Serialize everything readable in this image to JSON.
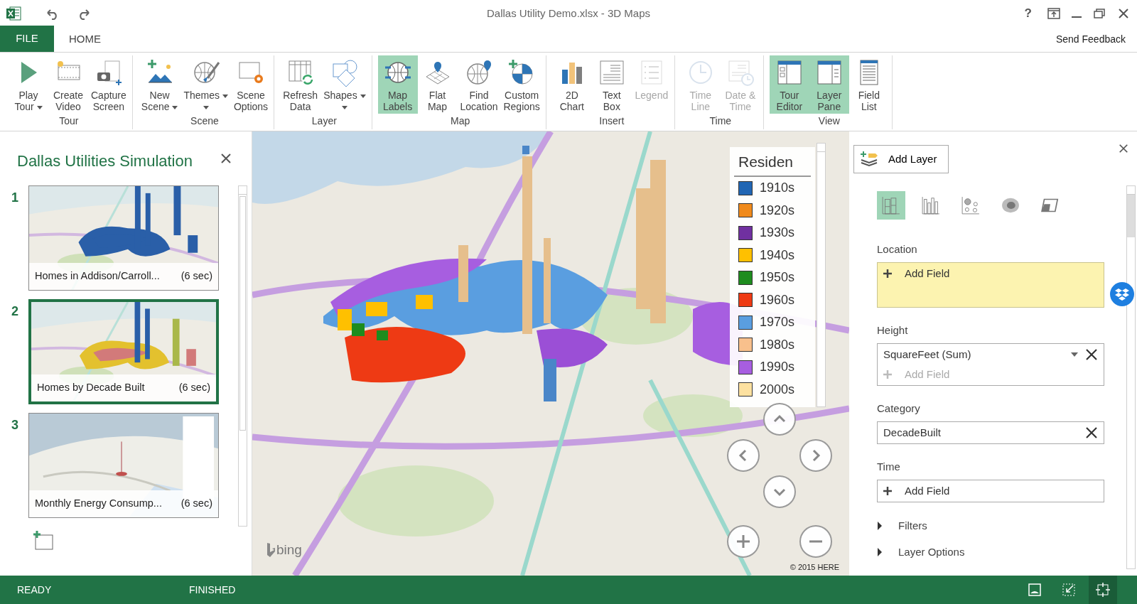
{
  "window": {
    "title": "Dallas Utility Demo.xlsx - 3D Maps",
    "help": "?"
  },
  "tabs": [
    {
      "label": "FILE",
      "kind": "file",
      "selected": false
    },
    {
      "label": "HOME",
      "kind": "tab",
      "selected": true
    }
  ],
  "send_feedback": "Send Feedback",
  "ribbon": {
    "groups": [
      {
        "label": "Tour",
        "buttons": [
          {
            "lines": [
              "Play",
              "Tour"
            ],
            "dropdown": true,
            "selected": false,
            "disabled": false
          },
          {
            "lines": [
              "Create",
              "Video"
            ],
            "dropdown": false,
            "selected": false,
            "disabled": false
          },
          {
            "lines": [
              "Capture",
              "Screen"
            ],
            "dropdown": false,
            "selected": false,
            "disabled": false
          }
        ]
      },
      {
        "label": "Scene",
        "buttons": [
          {
            "lines": [
              "New",
              "Scene"
            ],
            "dropdown": true,
            "selected": false,
            "disabled": false
          },
          {
            "lines": [
              "Themes"
            ],
            "dropdown": true,
            "selected": false,
            "disabled": false
          },
          {
            "lines": [
              "Scene",
              "Options"
            ],
            "dropdown": false,
            "selected": false,
            "disabled": false
          }
        ]
      },
      {
        "label": "Layer",
        "buttons": [
          {
            "lines": [
              "Refresh",
              "Data"
            ],
            "dropdown": false,
            "selected": false,
            "disabled": false
          },
          {
            "lines": [
              "Shapes"
            ],
            "dropdown": true,
            "selected": false,
            "disabled": false
          }
        ]
      },
      {
        "label": "Map",
        "buttons": [
          {
            "lines": [
              "Map",
              "Labels"
            ],
            "dropdown": false,
            "selected": true,
            "disabled": false
          },
          {
            "lines": [
              "Flat",
              "Map"
            ],
            "dropdown": false,
            "selected": false,
            "disabled": false
          },
          {
            "lines": [
              "Find",
              "Location"
            ],
            "dropdown": false,
            "selected": false,
            "disabled": false
          },
          {
            "lines": [
              "Custom",
              "Regions"
            ],
            "dropdown": false,
            "selected": false,
            "disabled": false
          }
        ]
      },
      {
        "label": "Insert",
        "buttons": [
          {
            "lines": [
              "2D",
              "Chart"
            ],
            "dropdown": false,
            "selected": false,
            "disabled": false
          },
          {
            "lines": [
              "Text",
              "Box"
            ],
            "dropdown": false,
            "selected": false,
            "disabled": false
          },
          {
            "lines": [
              "Legend"
            ],
            "dropdown": false,
            "selected": false,
            "disabled": true
          }
        ]
      },
      {
        "label": "Time",
        "buttons": [
          {
            "lines": [
              "Time",
              "Line"
            ],
            "dropdown": false,
            "selected": false,
            "disabled": true
          },
          {
            "lines": [
              "Date &",
              "Time"
            ],
            "dropdown": false,
            "selected": false,
            "disabled": true
          }
        ]
      },
      {
        "label": "View",
        "buttons": [
          {
            "lines": [
              "Tour",
              "Editor"
            ],
            "dropdown": false,
            "selected": true,
            "disabled": false
          },
          {
            "lines": [
              "Layer",
              "Pane"
            ],
            "dropdown": false,
            "selected": true,
            "disabled": false
          },
          {
            "lines": [
              "Field",
              "List"
            ],
            "dropdown": false,
            "selected": false,
            "disabled": false
          }
        ]
      }
    ]
  },
  "tour": {
    "title": "Dallas Utilities Simulation",
    "scenes": [
      {
        "number": "1",
        "caption": "Homes in Addison/Carroll...",
        "duration": "(6 sec)",
        "selected": false
      },
      {
        "number": "2",
        "caption": "Homes by Decade Built",
        "duration": "(6 sec)",
        "selected": true
      },
      {
        "number": "3",
        "caption": "Monthly Energy Consump...",
        "duration": "(6 sec)",
        "selected": false
      }
    ]
  },
  "map": {
    "legend": {
      "title": "Residen",
      "items": [
        {
          "label": "1910s",
          "color": "#2166b4"
        },
        {
          "label": "1920s",
          "color": "#f08a1c"
        },
        {
          "label": "1930s",
          "color": "#7030a0"
        },
        {
          "label": "1940s",
          "color": "#ffc000"
        },
        {
          "label": "1950s",
          "color": "#1e8c1e"
        },
        {
          "label": "1960s",
          "color": "#ee3a14"
        },
        {
          "label": "1970s",
          "color": "#5a9ee0"
        },
        {
          "label": "1980s",
          "color": "#f8c08c"
        },
        {
          "label": "1990s",
          "color": "#a75ee0"
        },
        {
          "label": "2000s",
          "color": "#fde1a0"
        }
      ]
    },
    "logo": "bing",
    "attribution": "© 2015 HERE"
  },
  "layer_pane": {
    "add_layer": "Add Layer",
    "viz_types": [
      {
        "selected": true
      },
      {
        "selected": false
      },
      {
        "selected": false
      },
      {
        "selected": false
      },
      {
        "selected": false
      }
    ],
    "wells": [
      {
        "label": "Location",
        "highlighted": true,
        "add": "Add Field",
        "add_disabled": false
      },
      {
        "label": "Height",
        "highlighted": false,
        "items": [
          {
            "value": "SquareFeet (Sum)",
            "dropdown": true
          }
        ],
        "add": "Add Field",
        "add_disabled": true
      },
      {
        "label": "Category",
        "highlighted": false,
        "items": [
          {
            "value": "DecadeBuilt",
            "dropdown": false
          }
        ]
      },
      {
        "label": "Time",
        "highlighted": false,
        "add": "Add Field",
        "add_disabled": false
      }
    ],
    "sections": [
      {
        "label": "Filters",
        "expanded": false
      },
      {
        "label": "Layer Options",
        "expanded": false
      }
    ]
  },
  "status_bar": {
    "texts": [
      "READY",
      "FINISHED"
    ],
    "view_buttons": [
      {
        "selected": false
      },
      {
        "selected": false
      },
      {
        "selected": true
      }
    ]
  }
}
